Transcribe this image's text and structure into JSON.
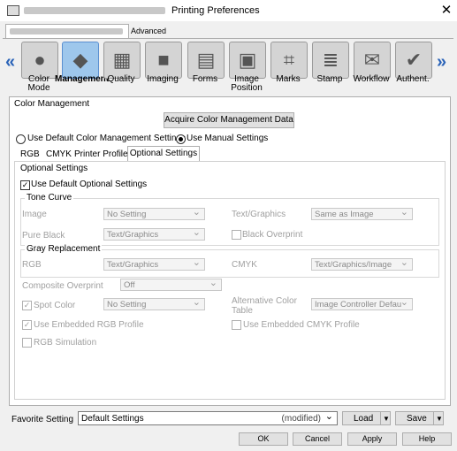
{
  "window": {
    "title": "Printing Preferences",
    "close_glyph": "✕"
  },
  "tabs": {
    "advanced": "Advanced"
  },
  "icons": [
    {
      "label": "Color\nMode",
      "icon": "color-mode-icon"
    },
    {
      "label": "Management",
      "icon": "management-icon",
      "selected": true
    },
    {
      "label": "Quality",
      "icon": "quality-icon"
    },
    {
      "label": "Imaging",
      "icon": "imaging-icon"
    },
    {
      "label": "Forms",
      "icon": "forms-icon"
    },
    {
      "label": "Image\nPosition",
      "icon": "image-position-icon"
    },
    {
      "label": "Marks",
      "icon": "marks-icon"
    },
    {
      "label": "Stamp",
      "icon": "stamp-icon"
    },
    {
      "label": "Workflow",
      "icon": "workflow-icon"
    },
    {
      "label": "Authent.",
      "icon": "authent-icon"
    }
  ],
  "nav": {
    "prev": "«",
    "next": "»"
  },
  "color_management": {
    "heading": "Color Management",
    "acquire_button": "Acquire Color Management Data",
    "radio_default": "Use Default Color Management Settings",
    "radio_manual": "Use Manual Settings",
    "selected_radio": "manual"
  },
  "subtabs": [
    "RGB",
    "CMYK",
    "Printer Profile",
    "Optional Settings"
  ],
  "active_subtab": "Optional Settings",
  "optional": {
    "heading": "Optional Settings",
    "use_default_label": "Use Default Optional Settings",
    "use_default_checked": true,
    "tone_curve": {
      "title": "Tone Curve",
      "image_label": "Image",
      "image_value": "No Setting",
      "text_label": "Text/Graphics",
      "text_value": "Same as Image",
      "pure_black_label": "Pure Black",
      "pure_black_value": "Text/Graphics",
      "black_overprint_label": "Black Overprint"
    },
    "gray": {
      "title": "Gray Replacement",
      "rgb_label": "RGB",
      "rgb_value": "Text/Graphics",
      "cmyk_label": "CMYK",
      "cmyk_value": "Text/Graphics/Image"
    },
    "composite_label": "Composite Overprint",
    "composite_value": "Off",
    "spot_label": "Spot Color",
    "spot_value": "No Setting",
    "spot_checked": true,
    "alt_label_1": "Alternative Color",
    "alt_label_2": "Table",
    "alt_value": "Image Controller Defau",
    "emb_rgb_label": "Use Embedded RGB Profile",
    "emb_rgb_checked": true,
    "emb_cmyk_label": "Use Embedded CMYK Profile",
    "rgb_sim_label": "RGB Simulation"
  },
  "bottom": {
    "favorite_label": "Favorite Setting",
    "favorite_value": "Default Settings",
    "favorite_suffix": "(modified)",
    "load": "Load",
    "save": "Save",
    "ok": "OK",
    "cancel": "Cancel",
    "apply": "Apply",
    "help": "Help"
  }
}
